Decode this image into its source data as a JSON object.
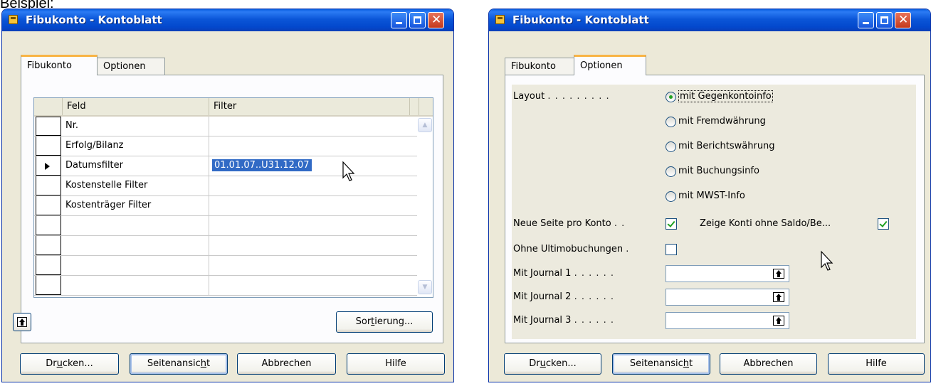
{
  "caption": "Beispiel:",
  "window1": {
    "title": "Fibukonto - Kontoblatt",
    "tabs": [
      {
        "label": "Fibukonto",
        "active": true
      },
      {
        "label": "Optionen",
        "active": false
      }
    ],
    "grid": {
      "columns": [
        "Feld",
        "Filter"
      ],
      "rows": [
        {
          "feld": "Nr.",
          "filter": "",
          "current": false
        },
        {
          "feld": "Erfolg/Bilanz",
          "filter": "",
          "current": false
        },
        {
          "feld": "Datumsfilter",
          "filter": "01.01.07..U31.12.07",
          "current": true
        },
        {
          "feld": "Kostenstelle Filter",
          "filter": "",
          "current": false
        },
        {
          "feld": "Kostenträger Filter",
          "filter": "",
          "current": false
        },
        {
          "feld": "",
          "filter": "",
          "current": false
        },
        {
          "feld": "",
          "filter": "",
          "current": false
        },
        {
          "feld": "",
          "filter": "",
          "current": false
        },
        {
          "feld": "",
          "filter": "",
          "current": false
        }
      ]
    },
    "sort_button": {
      "label_pre": "Sor",
      "label_ul": "t",
      "label_post": "ierung..."
    }
  },
  "window2": {
    "title": "Fibukonto - Kontoblatt",
    "tabs": [
      {
        "label": "Fibukonto",
        "active": false
      },
      {
        "label": "Optionen",
        "active": true
      }
    ],
    "layout_label": "Layout",
    "layout_options": [
      {
        "label": "mit Gegenkontoinfo",
        "checked": true
      },
      {
        "label": "mit Fremdwährung",
        "checked": false
      },
      {
        "label": "mit Berichtswährung",
        "checked": false
      },
      {
        "label": "mit Buchungsinfo",
        "checked": false
      },
      {
        "label": "mit MWST-Info",
        "checked": false
      }
    ],
    "neue_seite_label": "Neue Seite pro Konto",
    "neue_seite_checked": true,
    "zeige_konti_label": "Zeige Konti ohne Saldo/Be...",
    "zeige_konti_checked": true,
    "ohne_ultimo_label": "Ohne Ultimobuchungen",
    "ohne_ultimo_checked": false,
    "journals": [
      {
        "label": "Mit Journal 1",
        "value": ""
      },
      {
        "label": "Mit Journal 2",
        "value": ""
      },
      {
        "label": "Mit Journal 3",
        "value": ""
      }
    ]
  },
  "footer_buttons": {
    "drucken": {
      "pre": "Dr",
      "ul": "u",
      "post": "cken..."
    },
    "seitenansicht": {
      "pre": "Seitenansic",
      "ul": "h",
      "post": "t"
    },
    "abbrechen": "Abbrechen",
    "hilfe": "Hilfe"
  },
  "colors": {
    "titlebar": "#0348cd",
    "selection": "#316ac5",
    "active_tab_accent": "#f8b445",
    "check_green": "#21a121"
  }
}
